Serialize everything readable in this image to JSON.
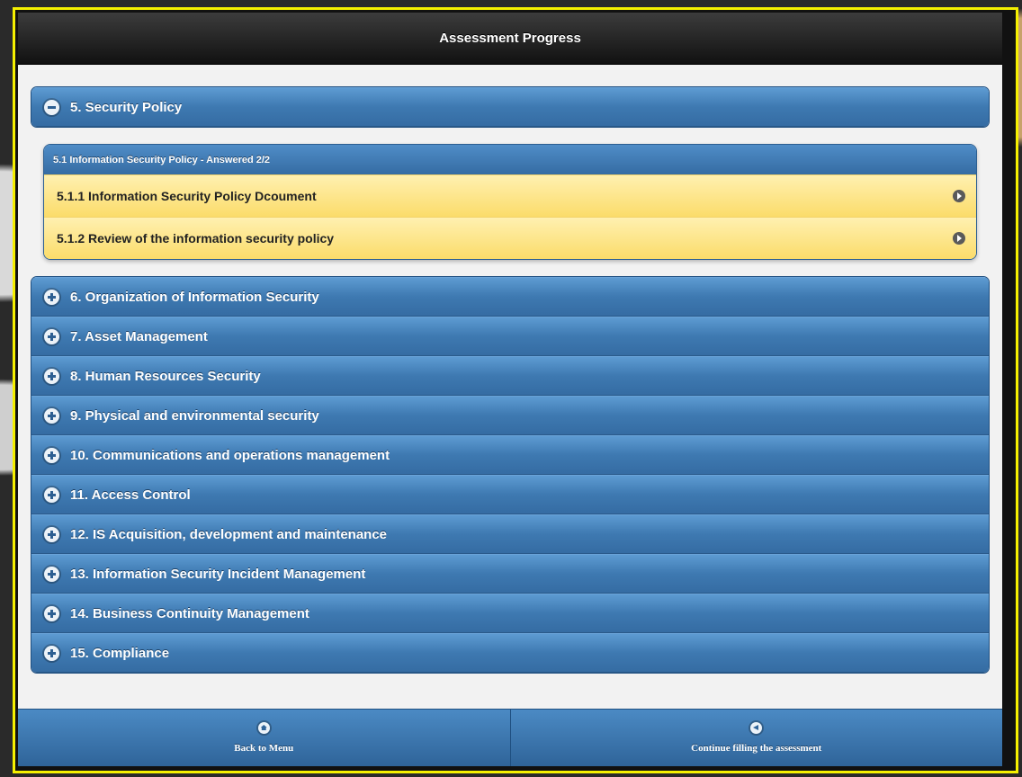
{
  "header": {
    "title": "Assessment Progress"
  },
  "expanded_section": {
    "label": "5. Security Policy",
    "icon": "minus-icon",
    "subgroup": {
      "title": "5.1 Information Security Policy - Answered 2/2",
      "items": [
        {
          "label": "5.1.1 Information Security Policy Dcoument",
          "icon": "arrow-right-icon"
        },
        {
          "label": "5.1.2 Review of the information security policy",
          "icon": "arrow-right-icon"
        }
      ]
    }
  },
  "sections": [
    {
      "label": "6. Organization of Information Security",
      "icon": "plus-icon"
    },
    {
      "label": "7. Asset Management",
      "icon": "plus-icon"
    },
    {
      "label": "8. Human Resources Security",
      "icon": "plus-icon"
    },
    {
      "label": "9. Physical and environmental security",
      "icon": "plus-icon"
    },
    {
      "label": "10. Communications and operations management",
      "icon": "plus-icon"
    },
    {
      "label": "11. Access Control",
      "icon": "plus-icon"
    },
    {
      "label": "12. IS Acquisition, development and maintenance",
      "icon": "plus-icon"
    },
    {
      "label": "13. Information Security Incident Management",
      "icon": "plus-icon"
    },
    {
      "label": "14. Business Continuity Management",
      "icon": "plus-icon"
    },
    {
      "label": "15. Compliance",
      "icon": "plus-icon"
    }
  ],
  "footer": {
    "back_label": "Back to Menu",
    "back_icon": "home-icon",
    "continue_label": "Continue filling the assessment",
    "continue_icon": "back-arrow-icon"
  },
  "colors": {
    "header_bg": "#1a1a1a",
    "section_blue": "#3e79b1",
    "item_yellow": "#fbdc6a",
    "frame_highlight": "#f5f000"
  }
}
